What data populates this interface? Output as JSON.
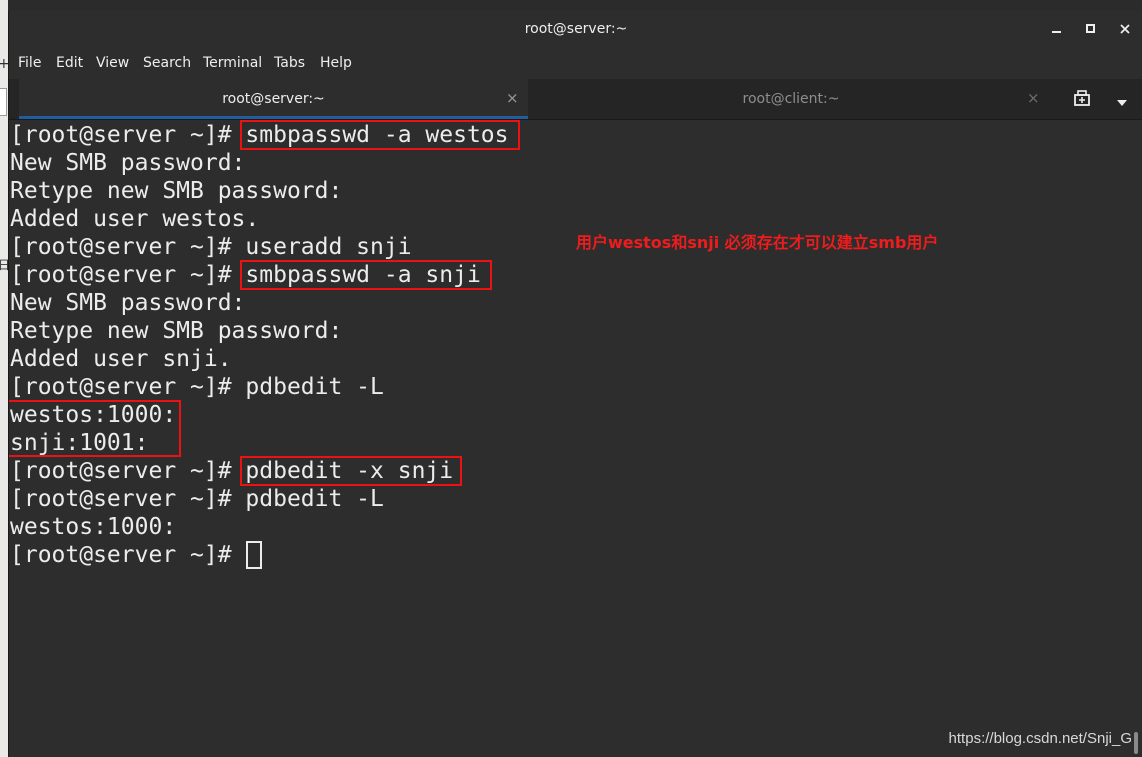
{
  "desktop": {
    "glyphs": [
      "+",
      "|",
      "日"
    ]
  },
  "window": {
    "title": "root@server:~",
    "controls": {
      "minimize": "–",
      "maximize": "□",
      "close": "×"
    }
  },
  "menubar": {
    "items": [
      "File",
      "Edit",
      "View",
      "Search",
      "Terminal",
      "Tabs",
      "Help"
    ]
  },
  "tabs": [
    {
      "label": "root@server:~",
      "close": "×",
      "active": true
    },
    {
      "label": "root@client:~",
      "close": "×",
      "active": false
    }
  ],
  "terminal": {
    "lines": [
      "[root@server ~]# smbpasswd -a westos",
      "New SMB password:",
      "Retype new SMB password:",
      "Added user westos.",
      "[root@server ~]# useradd snji",
      "[root@server ~]# smbpasswd -a snji",
      "New SMB password:",
      "Retype new SMB password:",
      "Added user snji.",
      "[root@server ~]# pdbedit -L",
      "westos:1000:",
      "snji:1001:",
      "[root@server ~]# pdbedit -x snji",
      "[root@server ~]# pdbedit -L",
      "westos:1000:",
      "[root@server ~]# "
    ],
    "annotation": "用户westos和snji 必须存在才可以建立smb用户"
  },
  "watermark": "https://blog.csdn.net/Snji_G",
  "colors": {
    "terminal_bg": "#2d2d2d",
    "terminal_fg": "#ececec",
    "highlight": "#ee1111",
    "tab_accent": "#215d9c"
  }
}
